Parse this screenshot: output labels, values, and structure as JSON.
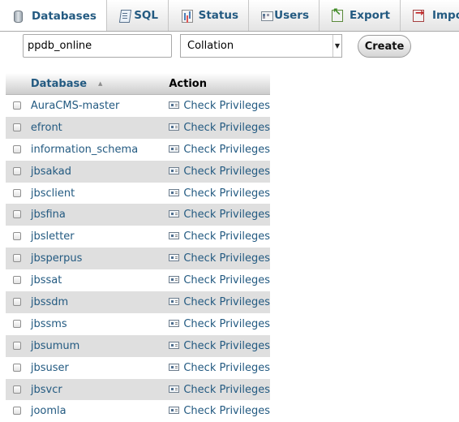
{
  "tabs": [
    {
      "label": "Databases",
      "icon": "database-icon",
      "active": true
    },
    {
      "label": "SQL",
      "icon": "sql-icon",
      "active": false
    },
    {
      "label": "Status",
      "icon": "status-icon",
      "active": false
    },
    {
      "label": "Users",
      "icon": "users-icon",
      "active": false
    },
    {
      "label": "Export",
      "icon": "export-icon",
      "active": false
    },
    {
      "label": "Impo",
      "icon": "import-icon",
      "active": false
    }
  ],
  "create_form": {
    "db_name_value": "ppdb_online",
    "collation_value": "Collation",
    "create_label": "Create"
  },
  "table": {
    "headers": {
      "database": "Database",
      "action": "Action"
    },
    "action_label": "Check Privileges",
    "rows": [
      {
        "name": "AuraCMS-master"
      },
      {
        "name": "efront"
      },
      {
        "name": "information_schema"
      },
      {
        "name": "jbsakad"
      },
      {
        "name": "jbsclient"
      },
      {
        "name": "jbsfina"
      },
      {
        "name": "jbsletter"
      },
      {
        "name": "jbsperpus"
      },
      {
        "name": "jbssat"
      },
      {
        "name": "jbssdm"
      },
      {
        "name": "jbssms"
      },
      {
        "name": "jbsumum"
      },
      {
        "name": "jbsuser"
      },
      {
        "name": "jbsvcr"
      },
      {
        "name": "joomla"
      }
    ]
  },
  "colors": {
    "link": "#235a81",
    "row_alt": "#dfdfdf"
  }
}
